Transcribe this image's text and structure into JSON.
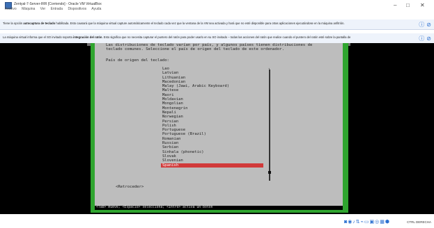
{
  "window": {
    "title": "Zentyal-7-Server-IRR [Corriendo] - Oracle VM VirtualBox",
    "menu": [
      "Archivo",
      "Máquina",
      "Ver",
      "Entrada",
      "Dispositivos",
      "Ayuda"
    ],
    "controls": [
      "minimize",
      "maximize",
      "close"
    ]
  },
  "notifications": {
    "keyboard": {
      "text_prefix": "Tiene la opción ",
      "text_bold": "autocaptura de teclado",
      "text_rest": " habilitada. Esto causará que la máquina virtual capture automáticamente el teclado cada vez que la ventana de la VM sea activada y hará que no esté disponible para otras aplicaciones ejecutándose en la máquina anfitrión.",
      "icons": [
        "info-icon",
        "close-icon"
      ]
    },
    "mouse": {
      "text_prefix": "La máquina virtual informa que el SO invitado soporta ",
      "text_bold": "integración del ratón",
      "text_rest": ". Esto significa que no necesita capturar el puntero del ratón para poder usarlo en su SO invitado – todas las acciones del ratón que realice cuando el puntero del ratón esté sobre la pantalla de",
      "icons": [
        "info-icon",
        "close-icon"
      ]
    }
  },
  "installer": {
    "intro_line_1": "Las distribuciones de teclado varían por país, y algunos países tienen distribuciones de",
    "intro_line_2": "teclado comunes. Seleccione el país de origen del teclado de este ordenador.",
    "prompt": "País de origen del teclado:",
    "items": [
      "Lao",
      "Latvian",
      "Lithuanian",
      "Macedonian",
      "Malay (Jawi, Arabic Keyboard)",
      "Maltese",
      "Maori",
      "Moldavian",
      "Mongolian",
      "Montenegrin",
      "Nepali",
      "Norwegian",
      "Persian",
      "Polish",
      "Portuguese",
      "Portuguese (Brazil)",
      "Romanian",
      "Russian",
      "Serbian",
      "Sinhala (phonetic)",
      "Slovak",
      "Slovenian",
      "Spanish"
    ],
    "selected_index": 22,
    "back_label": "<Retroceder>",
    "help_text": "<Tab> mueve; <Espacio> selecciona; <Intro> activa un botón",
    "colors": {
      "terminal_bg": "#bdbdbd",
      "frame": "#2fa52f",
      "selection": "#d13a3a"
    }
  },
  "statusbar": {
    "icons": [
      "hard-disk-icon",
      "optical-drive-icon",
      "audio-icon",
      "network-icon",
      "usb-icon",
      "shared-folder-icon",
      "display-icon",
      "recording-icon",
      "cpu-icon",
      "mouse-integration-icon"
    ],
    "host_key": "CTRL DERECHA"
  }
}
